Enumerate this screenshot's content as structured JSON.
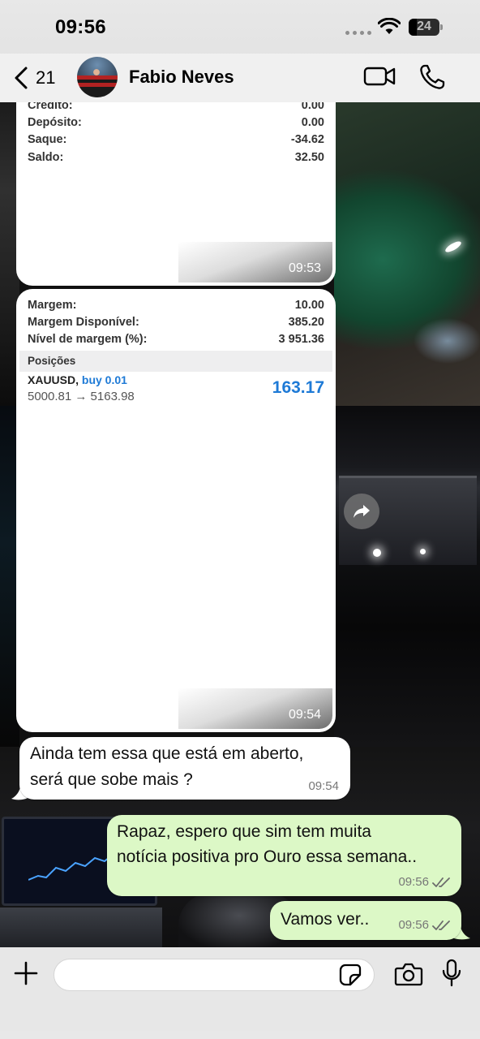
{
  "status_bar": {
    "time": "09:56",
    "battery_level": "24"
  },
  "header": {
    "back_count": "21",
    "contact_name": "Fabio Neves"
  },
  "messages": {
    "image1": {
      "rows": [
        {
          "label": "Crédito:",
          "value": "0.00"
        },
        {
          "label": "Depósito:",
          "value": "0.00"
        },
        {
          "label": "Saque:",
          "value": "-34.62"
        },
        {
          "label": "Saldo:",
          "value": "32.50"
        }
      ],
      "time": "09:53"
    },
    "image2": {
      "rows": [
        {
          "label": "Margem:",
          "value": "10.00"
        },
        {
          "label": "Margem Disponível:",
          "value": "385.20"
        },
        {
          "label": "Nível de margem (%):",
          "value": "3 951.36"
        }
      ],
      "section": "Posições",
      "position": {
        "symbol": "XAUUSD,",
        "side": "buy 0.01",
        "prices": "5000.81 → 5163.98",
        "profit": "163.17"
      },
      "time": "09:54"
    },
    "incoming": {
      "line1": "Ainda tem essa que está em aberto,",
      "line2": "será que sobe mais ?",
      "time": "09:54"
    },
    "outgoing1": {
      "line1": "Rapaz, espero que sim tem muita",
      "line2": "notícia positiva pro Ouro essa semana..",
      "time": "09:56"
    },
    "outgoing2": {
      "text": "Vamos ver..",
      "time": "09:56"
    }
  },
  "colors": {
    "outgoing_bubble": "#dcf8c6",
    "profit_blue": "#1e7ad6",
    "read_ticks": "#6b6b6b"
  },
  "icons": [
    "back-chevron-icon",
    "video-call-icon",
    "voice-call-icon",
    "forward-icon",
    "plus-icon",
    "sticker-icon",
    "camera-icon",
    "mic-icon",
    "wifi-icon",
    "read-ticks-icon"
  ]
}
